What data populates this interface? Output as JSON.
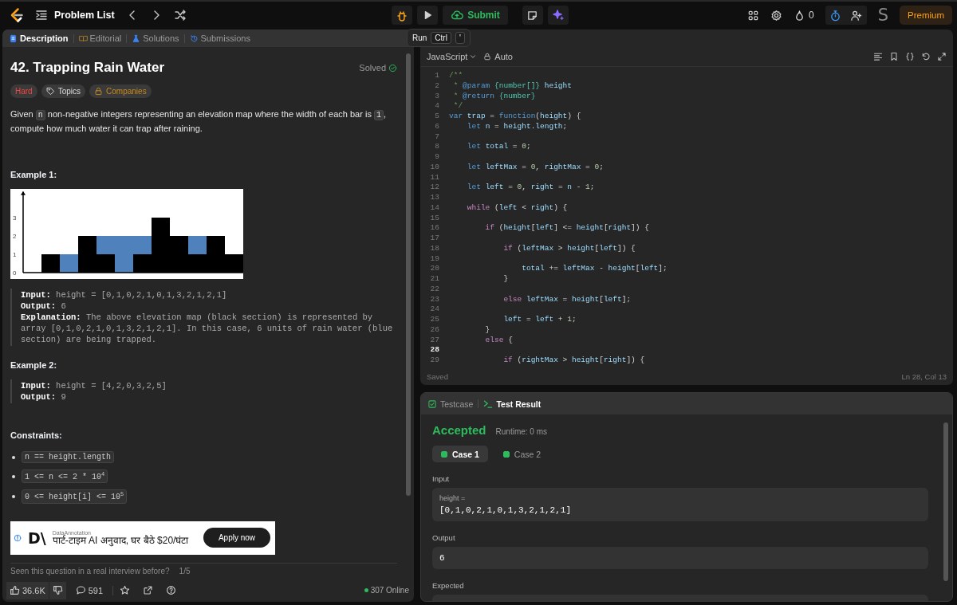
{
  "topbar": {
    "nav_title": "Problem List",
    "submit": "Submit",
    "streak": "0",
    "avatar": "S",
    "premium": "Premium"
  },
  "run_tooltip": {
    "label": "Run",
    "keys": [
      "Ctrl",
      "'"
    ]
  },
  "description": {
    "tabs": [
      {
        "label": "Description",
        "selected": true
      },
      {
        "label": "Editorial",
        "selected": false
      },
      {
        "label": "Solutions",
        "selected": false
      },
      {
        "label": "Submissions",
        "selected": false
      }
    ],
    "title": "42. Trapping Rain Water",
    "status": "Solved",
    "tags": [
      {
        "kind": "difficulty",
        "label": "Hard"
      },
      {
        "kind": "topics",
        "label": "Topics"
      },
      {
        "kind": "companies",
        "label": "Companies"
      }
    ],
    "statement": [
      {
        "kind": "text",
        "text": "Given "
      },
      {
        "kind": "code",
        "text": "n"
      },
      {
        "kind": "text",
        "text": " non-negative integers representing an elevation map where the width of each bar is "
      },
      {
        "kind": "code",
        "text": "1"
      },
      {
        "kind": "text",
        "text": ", compute how much water it can trap after raining."
      }
    ],
    "examples": [
      {
        "title": "Example 1:",
        "chart_data": {
          "type": "bar",
          "stacked": true,
          "yticks": [
            0,
            1,
            2,
            3
          ],
          "ylim": [
            0,
            4.4
          ],
          "series": [
            {
              "color": "#000000",
              "values": [
                0,
                1,
                0,
                2,
                1,
                0,
                1,
                3,
                2,
                1,
                2,
                1
              ]
            },
            {
              "color": "#4f81bd",
              "values": [
                0,
                0,
                1,
                0,
                1,
                2,
                1,
                0,
                0,
                1,
                0,
                0
              ]
            }
          ]
        },
        "lines": [
          {
            "label": "Input:",
            "text": "height = [0,1,0,2,1,0,1,3,2,1,2,1]"
          },
          {
            "label": "Output:",
            "text": "6"
          },
          {
            "label": "Explanation:",
            "text": "The above elevation map (black section) is represented by array [0,1,0,2,1,0,1,3,2,1,2,1]. In this case, 6 units of rain water (blue section) are being trapped."
          }
        ]
      },
      {
        "title": "Example 2:",
        "lines": [
          {
            "label": "Input:",
            "text": "height = [4,2,0,3,2,5]"
          },
          {
            "label": "Output:",
            "text": "9"
          }
        ]
      }
    ],
    "constraints_title": "Constraints:",
    "constraints": [
      "n == height.length",
      "1 <= n <= 2 * 10$^{4}$",
      "0 <= height[i] <= 10$^{5}$"
    ],
    "ad": {
      "advertiser": "DataAnnotation",
      "logo": "D\\",
      "headline": "पार्ट-टाइम AI अनुवाद, घर बैठे $20/घंटा",
      "button": "Apply now"
    },
    "interview_prompt": "Seen this question in a real interview before?",
    "interview_count": "1/5",
    "footer": {
      "likes": "36.6K",
      "comments": "591",
      "online": "307 Online"
    }
  },
  "editor": {
    "language": "JavaScript",
    "mode": "Auto",
    "status": "Saved",
    "cursor": "Ln 28, Col 13",
    "lines": [
      {
        "no": "1",
        "current": false,
        "text": "/**"
      },
      {
        "no": "2",
        "current": false,
        "text": " * @param {number[]} height"
      },
      {
        "no": "3",
        "current": false,
        "text": " * @return {number}"
      },
      {
        "no": "4",
        "current": false,
        "text": " */"
      },
      {
        "no": "5",
        "current": false,
        "text": "var trap = function(height) {"
      },
      {
        "no": "6",
        "current": false,
        "text": "    let n = height.length;"
      },
      {
        "no": "7",
        "current": false
      },
      {
        "no": "8",
        "current": false,
        "text": "    let total = 0;"
      },
      {
        "no": "9",
        "current": false
      },
      {
        "no": "10",
        "current": false,
        "text": "    let leftMax = 0, rightMax = 0;"
      },
      {
        "no": "11",
        "current": false
      },
      {
        "no": "12",
        "current": false,
        "text": "    let left = 0, right = n - 1;"
      },
      {
        "no": "13",
        "current": false
      },
      {
        "no": "14",
        "current": false,
        "text": "    while (left < right) {"
      },
      {
        "no": "15",
        "current": false
      },
      {
        "no": "16",
        "current": false,
        "text": "        if (height[left] <= height[right]) {"
      },
      {
        "no": "17",
        "current": false
      },
      {
        "no": "18",
        "current": false,
        "text": "            if (leftMax > height[left]) {"
      },
      {
        "no": "19",
        "current": false
      },
      {
        "no": "20",
        "current": false,
        "text": "                total += leftMax - height[left];"
      },
      {
        "no": "21",
        "current": false,
        "text": "            }"
      },
      {
        "no": "22",
        "current": false
      },
      {
        "no": "23",
        "current": false,
        "text": "            else leftMax = height[left];"
      },
      {
        "no": "24",
        "current": false
      },
      {
        "no": "25",
        "current": false,
        "text": "            left = left + 1;"
      },
      {
        "no": "26",
        "current": false,
        "text": "        }"
      },
      {
        "no": "27",
        "current": false,
        "text": "        else {"
      },
      {
        "no": "28",
        "current": true
      },
      {
        "no": "29",
        "current": false,
        "text": "            if (rightMax > height[right]) {"
      }
    ]
  },
  "result": {
    "tabs": [
      {
        "label": "Testcase",
        "selected": false
      },
      {
        "label": "Test Result",
        "selected": true
      }
    ],
    "verdict": "Accepted",
    "runtime": "Runtime: 0 ms",
    "cases": [
      {
        "label": "Case 1",
        "selected": true,
        "passed": true
      },
      {
        "label": "Case 2",
        "selected": false,
        "passed": true
      }
    ],
    "input_label": "Input",
    "inputs": [
      {
        "name": "height =",
        "value": "[0,1,0,2,1,0,1,3,2,1,2,1]"
      }
    ],
    "output_label": "Output",
    "output": "6",
    "expected_label": "Expected"
  }
}
